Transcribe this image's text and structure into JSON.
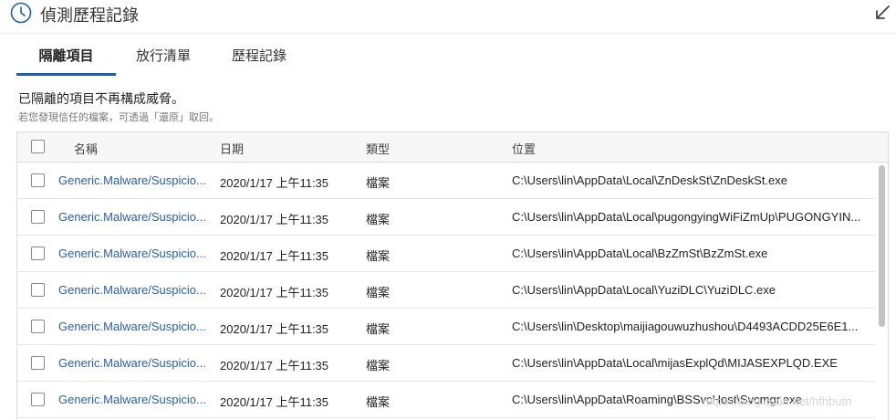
{
  "window": {
    "title": "偵測歷程記錄",
    "title_icon": "history-clock-icon",
    "shrink_icon": "shrink-arrow-icon"
  },
  "tabs": [
    {
      "label": "隔離項目",
      "active": true
    },
    {
      "label": "放行清單",
      "active": false
    },
    {
      "label": "歷程記錄",
      "active": false
    }
  ],
  "summary": {
    "text": "已隔離的項目不再構成威脅。",
    "hint": "若您發現信任的檔案，可透過「還原」取回。"
  },
  "table": {
    "columns": [
      "名稱",
      "日期",
      "類型",
      "位置"
    ],
    "rows": [
      {
        "name": "Generic.Malware/Suspicio...",
        "date": "2020/1/17 上午11:35",
        "type": "檔案",
        "location": "C:\\Users\\lin\\AppData\\Local\\ZnDeskSt\\ZnDeskSt.exe"
      },
      {
        "name": "Generic.Malware/Suspicio...",
        "date": "2020/1/17 上午11:35",
        "type": "檔案",
        "location": "C:\\Users\\lin\\AppData\\Local\\pugongyingWiFiZmUp\\PUGONGYIN..."
      },
      {
        "name": "Generic.Malware/Suspicio...",
        "date": "2020/1/17 上午11:35",
        "type": "檔案",
        "location": "C:\\Users\\lin\\AppData\\Local\\BzZmSt\\BzZmSt.exe"
      },
      {
        "name": "Generic.Malware/Suspicio...",
        "date": "2020/1/17 上午11:35",
        "type": "檔案",
        "location": "C:\\Users\\lin\\AppData\\Local\\YuziDLC\\YuziDLC.exe"
      },
      {
        "name": "Generic.Malware/Suspicio...",
        "date": "2020/1/17 上午11:35",
        "type": "檔案",
        "location": "C:\\Users\\lin\\Desktop\\maijiagouwuzhushou\\D4493ACDD25E6E1..."
      },
      {
        "name": "Generic.Malware/Suspicio...",
        "date": "2020/1/17 上午11:35",
        "type": "檔案",
        "location": "C:\\Users\\lin\\AppData\\Local\\mijasExplQd\\MIJASEXPLQD.EXE"
      },
      {
        "name": "Generic.Malware/Suspicio...",
        "date": "2020/1/17 上午11:35",
        "type": "檔案",
        "location": "C:\\Users\\lin\\AppData\\Roaming\\BSSvcHost\\Svcmgr.exe"
      }
    ]
  },
  "watermark": "https://blog.csdn.net/hfhbutn",
  "colors": {
    "accent": "#1f5cb3",
    "link": "#2a5db0",
    "scrollbar": "#c2c2c2"
  }
}
